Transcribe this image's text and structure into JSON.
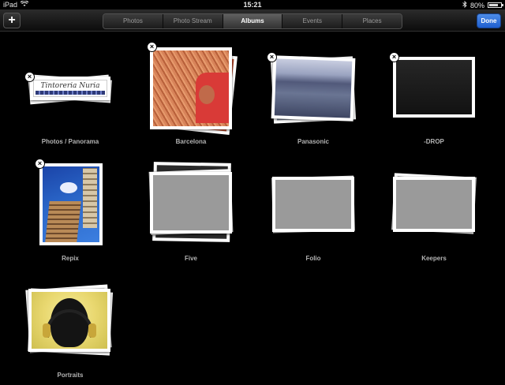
{
  "status": {
    "device": "iPad",
    "time": "15:21",
    "battery": "80%",
    "battery_level": 0.8
  },
  "toolbar": {
    "add_label": "+",
    "done_label": "Done",
    "tabs": [
      {
        "label": "Photos",
        "active": false
      },
      {
        "label": "Photo Stream",
        "active": false
      },
      {
        "label": "Albums",
        "active": true
      },
      {
        "label": "Events",
        "active": false
      },
      {
        "label": "Places",
        "active": false
      }
    ]
  },
  "albums": [
    {
      "name": "Photos / Panorama",
      "deletable": true,
      "banner_text": "Tintoreria Nuria"
    },
    {
      "name": "Barcelona",
      "deletable": true
    },
    {
      "name": "Panasonic",
      "deletable": true
    },
    {
      "name": "-DROP",
      "deletable": true
    },
    {
      "name": "Repix",
      "deletable": true
    },
    {
      "name": "Five",
      "deletable": false
    },
    {
      "name": "Folio",
      "deletable": false
    },
    {
      "name": "Keepers",
      "deletable": false
    },
    {
      "name": "Portraits",
      "deletable": false
    }
  ],
  "colors": {
    "accent": "#2f72dc",
    "background": "#000000",
    "label": "#b3b3b3"
  }
}
